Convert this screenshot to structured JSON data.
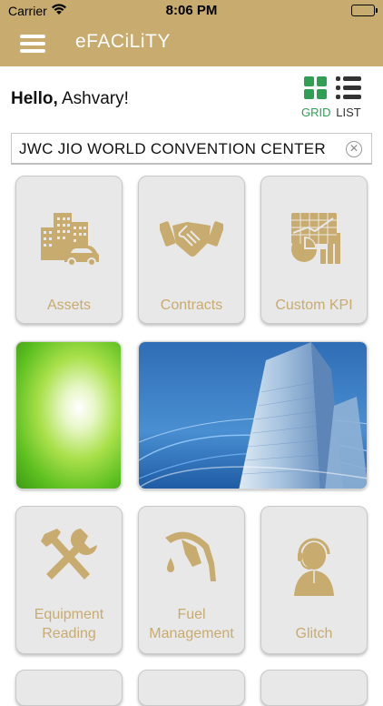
{
  "status_bar": {
    "carrier": "Carrier",
    "time": "8:06 PM"
  },
  "nav": {
    "title": "eFACiLiTY"
  },
  "greeting": {
    "hello": "Hello,",
    "name": "Ashvary!"
  },
  "view_toggle": {
    "grid_label": "GRID",
    "list_label": "LIST"
  },
  "search": {
    "value": "JWC JIO WORLD CONVENTION CENTER"
  },
  "tiles": [
    {
      "label": "Assets",
      "icon": "buildings-car-icon"
    },
    {
      "label": "Contracts",
      "icon": "handshake-icon"
    },
    {
      "label": "Custom KPI",
      "icon": "kpi-chart-icon"
    },
    {
      "label_line1": "Equipment",
      "label_line2": "Reading",
      "icon": "tools-icon"
    },
    {
      "label_line1": "Fuel",
      "label_line2": "Management",
      "icon": "fuel-nozzle-icon"
    },
    {
      "label": "Glitch",
      "icon": "support-agent-icon"
    }
  ],
  "colors": {
    "brand": "#c8ab6e",
    "active": "#2fa053"
  }
}
